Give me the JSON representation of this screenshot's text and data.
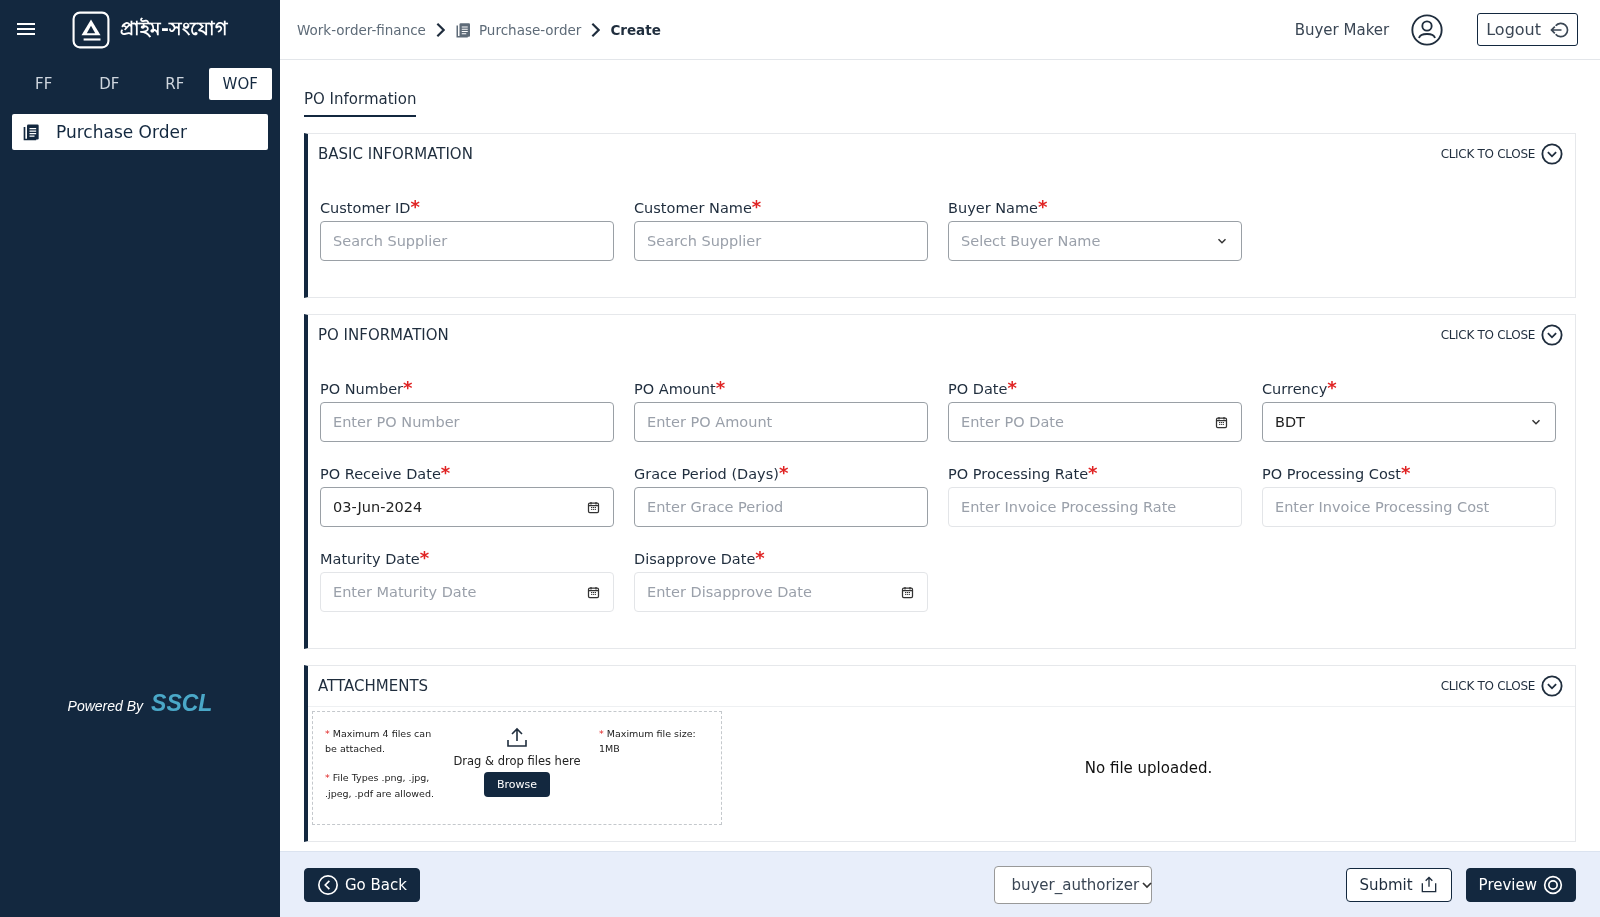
{
  "sidebar": {
    "logo_text": "প্রাইম-সংযোগ",
    "tabs": [
      {
        "label": "FF",
        "selected": false
      },
      {
        "label": "DF",
        "selected": false
      },
      {
        "label": "RF",
        "selected": false
      },
      {
        "label": "WOF",
        "selected": true
      }
    ],
    "items": [
      {
        "label": "Purchase Order",
        "selected": true
      }
    ],
    "powered_by": "Powered By",
    "brand": "SSCL"
  },
  "header": {
    "breadcrumb": [
      {
        "label": "Work-order-finance",
        "icon": false,
        "current": false
      },
      {
        "label": "Purchase-order",
        "icon": true,
        "current": false
      },
      {
        "label": "Create",
        "icon": false,
        "current": true
      }
    ],
    "user": "Buyer Maker",
    "logout": "Logout"
  },
  "page_tabs": [
    {
      "label": "PO Information",
      "selected": true
    }
  ],
  "sections": [
    {
      "title": "BASIC INFORMATION",
      "toggle": "CLICK TO CLOSE",
      "fields": [
        {
          "label": "Customer ID",
          "required_mark": "*",
          "kind": "text",
          "placeholder": "Search Supplier",
          "disabled": false
        },
        {
          "label": "Customer Name",
          "required_mark": "*",
          "kind": "text",
          "placeholder": "Search Supplier",
          "disabled": false
        },
        {
          "label": "Buyer Name",
          "required_mark": "*",
          "kind": "select",
          "placeholder": "Select Buyer Name",
          "disabled": false
        }
      ]
    },
    {
      "title": "PO INFORMATION",
      "toggle": "CLICK TO CLOSE",
      "fields": [
        {
          "label": "PO Number",
          "required_mark": "*",
          "kind": "text",
          "placeholder": "Enter PO Number",
          "disabled": false
        },
        {
          "label": "PO Amount",
          "required_mark": "*",
          "kind": "text",
          "placeholder": "Enter PO Amount",
          "disabled": false
        },
        {
          "label": "PO Date",
          "required_mark": "*",
          "kind": "date",
          "placeholder": "Enter PO Date",
          "disabled": false
        },
        {
          "label": "Currency",
          "required_mark": "*",
          "kind": "select",
          "value": "BDT",
          "disabled": false
        },
        {
          "label": "PO Receive Date",
          "required_mark": "*",
          "kind": "date",
          "value": "03-Jun-2024",
          "disabled": false
        },
        {
          "label": "Grace Period (Days)",
          "required_mark": "*",
          "kind": "text",
          "placeholder": "Enter Grace Period",
          "disabled": false
        },
        {
          "label": "PO Processing Rate",
          "required_mark": "*",
          "kind": "text",
          "placeholder": "Enter Invoice Processing Rate",
          "disabled": true
        },
        {
          "label": "PO Processing Cost",
          "required_mark": "*",
          "kind": "text",
          "placeholder": "Enter Invoice Processing Cost",
          "disabled": true
        },
        {
          "label": "Maturity Date",
          "required_mark": "*",
          "kind": "date",
          "placeholder": "Enter Maturity Date",
          "disabled": true
        },
        {
          "label": "Disapprove Date",
          "required_mark": "*",
          "kind": "date",
          "placeholder": "Enter Disapprove Date",
          "disabled": true
        }
      ]
    }
  ],
  "attachments": {
    "title": "ATTACHMENTS",
    "toggle": "CLICK TO CLOSE",
    "notes_left": [
      {
        "mark": "*",
        "text": "Maximum 4 files can be attached."
      },
      {
        "mark": "*",
        "text": "File Types .png, .jpg, .jpeg, .pdf are allowed."
      }
    ],
    "drop_text": "Drag & drop files here",
    "browse": "Browse",
    "notes_right": [
      {
        "mark": "*",
        "text": "Maximum file size: 1MB"
      }
    ],
    "empty_text": "No file uploaded."
  },
  "footer": {
    "back": "Go Back",
    "role": "buyer_authorizer",
    "submit": "Submit",
    "preview": "Preview"
  }
}
